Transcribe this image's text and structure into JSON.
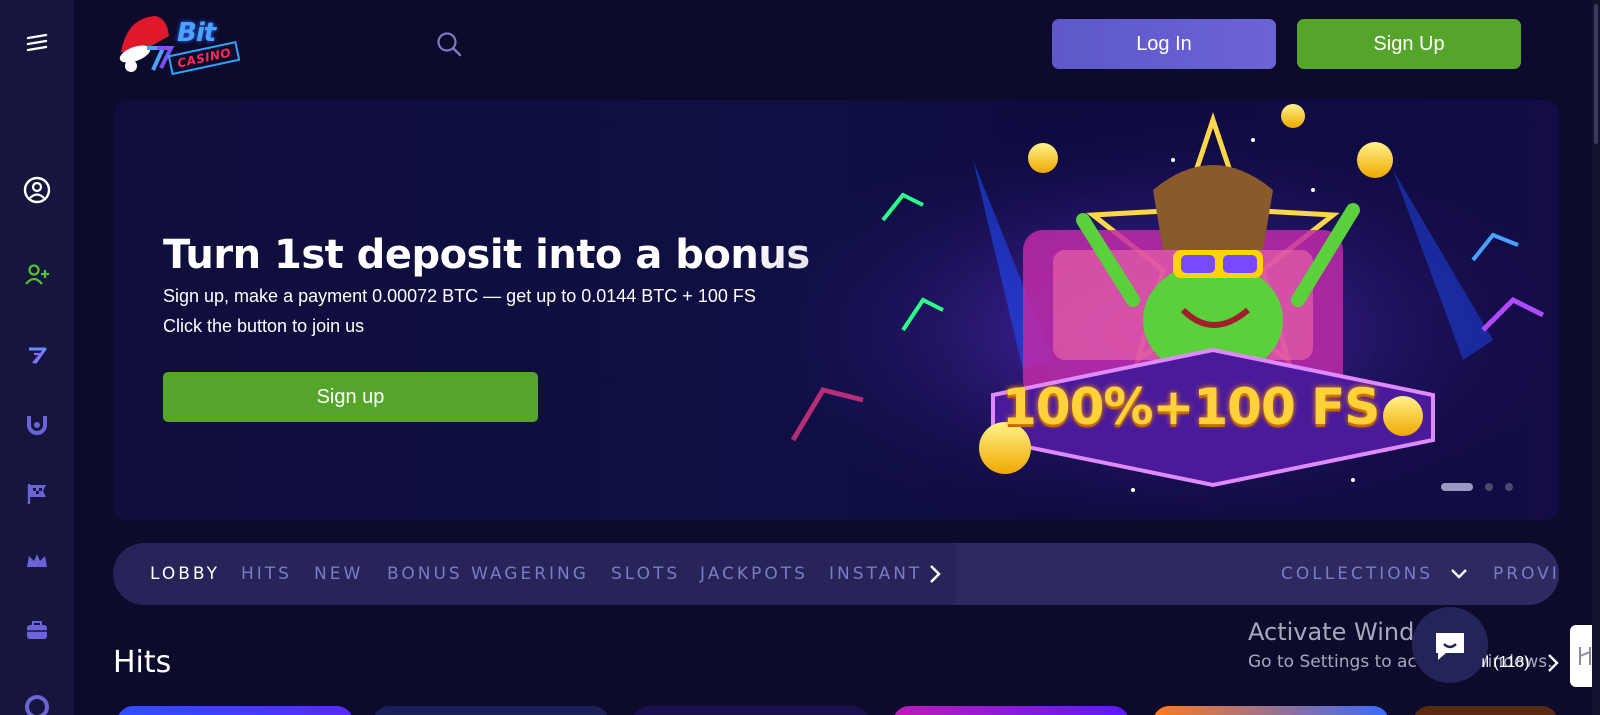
{
  "sidebar": {
    "items": [
      {
        "icon": "menu-icon"
      },
      {
        "icon": "user-circle-icon"
      },
      {
        "icon": "add-user-icon"
      },
      {
        "icon": "seven-logo-icon"
      },
      {
        "icon": "horseshoe-icon"
      },
      {
        "icon": "checkered-flag-icon"
      },
      {
        "icon": "crown-icon"
      },
      {
        "icon": "briefcase-icon"
      },
      {
        "icon": "lifebuoy-icon"
      }
    ]
  },
  "header": {
    "logo_text": "Bit",
    "logo_subtext": "CASINO",
    "login_label": "Log In",
    "signup_label": "Sign Up"
  },
  "banner": {
    "title": "Turn 1st deposit into a bonus",
    "subtitle1": "Sign up, make a payment 0.00072 BTC — get up to 0.0144 BTC + 100 FS",
    "subtitle2": "Click the button to join us",
    "button_label": "Sign up",
    "promo_text": "100%+100 FS",
    "slides_total": 3,
    "active_slide": 1
  },
  "category_nav": {
    "items": [
      "LOBBY",
      "HITS",
      "NEW",
      "BONUS WAGERING",
      "SLOTS",
      "JACKPOTS",
      "INSTANT"
    ],
    "active": "LOBBY",
    "collections_label": "COLLECTIONS",
    "providers_label": "PROVIDERS"
  },
  "hits": {
    "title": "Hits",
    "count_label": "ıl (118)"
  },
  "watermark": {
    "line1": "Activate Windows",
    "line2": "Go to Settings to activate Windows."
  },
  "colors": {
    "background": "#0c0b2b",
    "sidebar": "#16153d",
    "login_button": "#6b63d6",
    "signup_button": "#55a52a",
    "nav_bg": "#262458",
    "nav_text": "#7c7bc4"
  }
}
